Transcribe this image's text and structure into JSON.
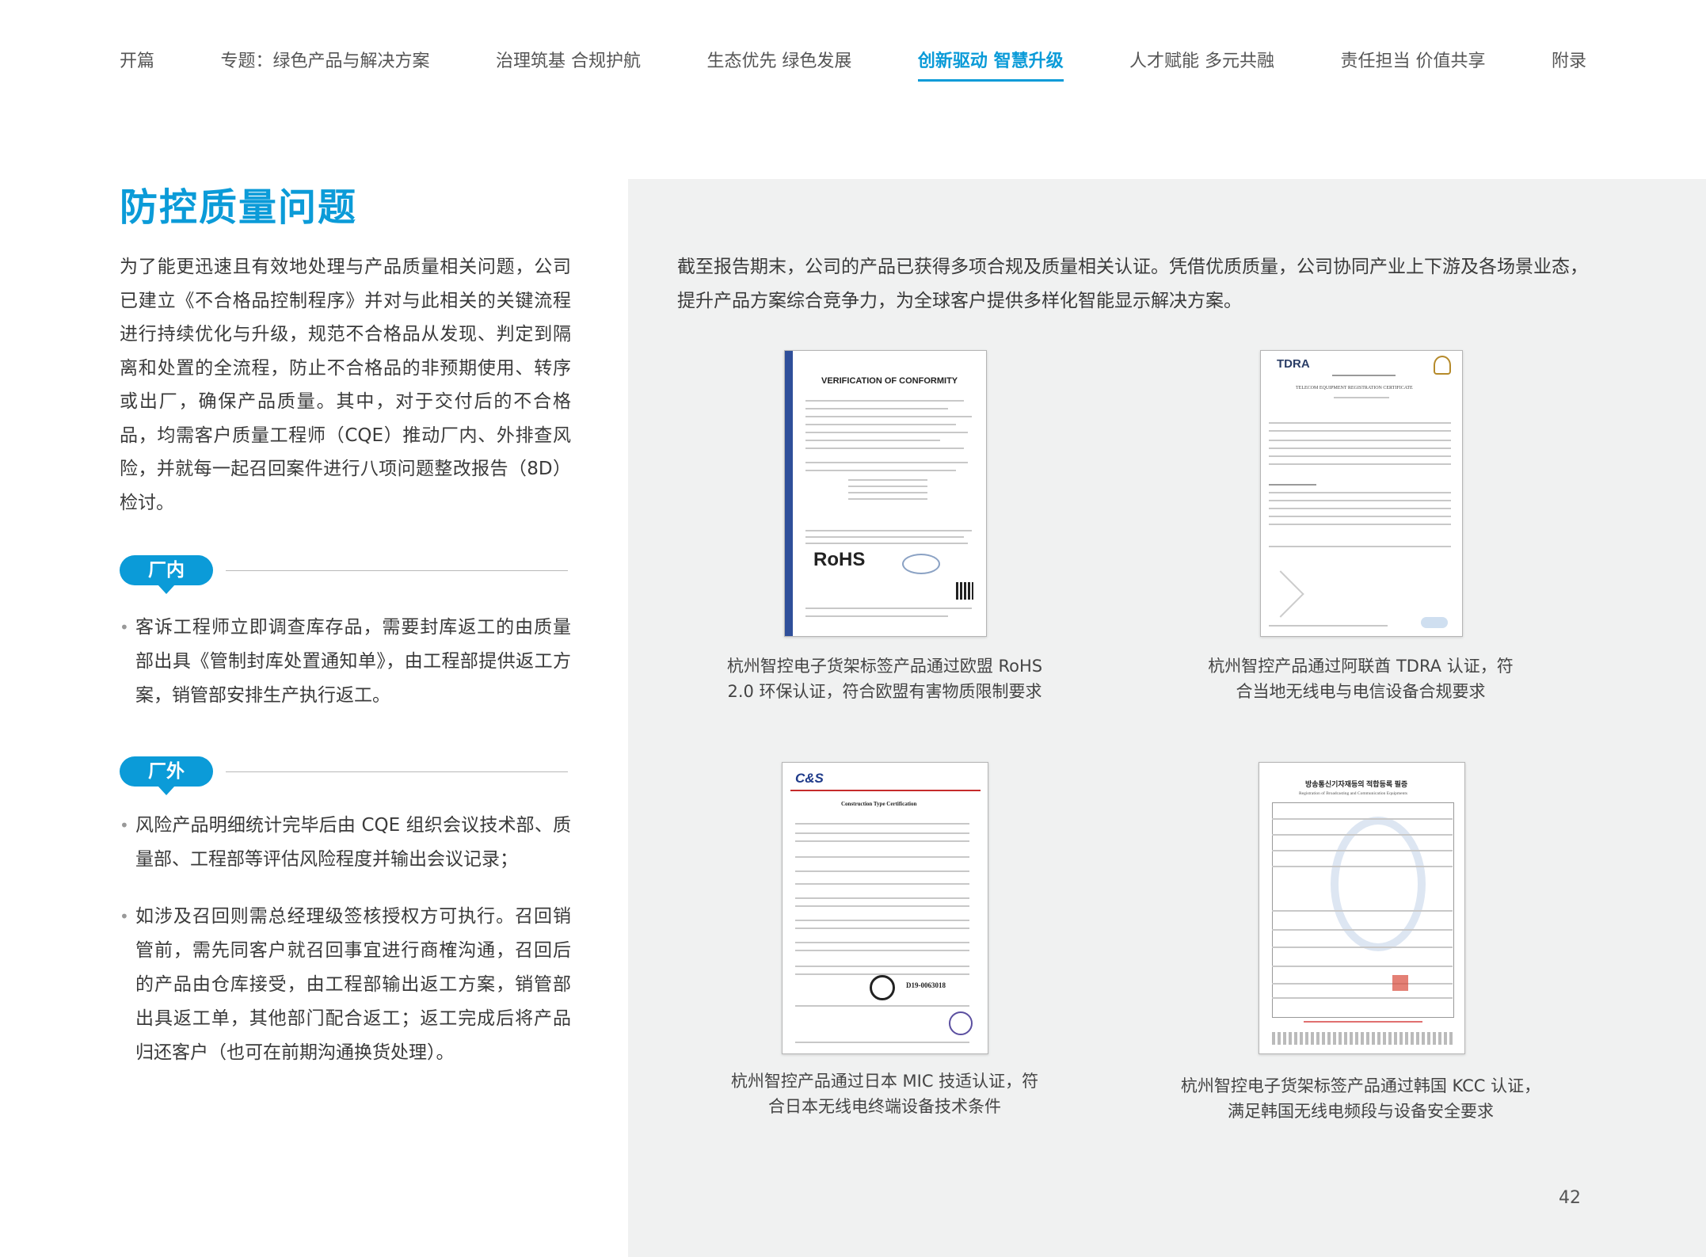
{
  "nav": {
    "items": [
      {
        "label": "开篇",
        "active": false
      },
      {
        "label": "专题：绿色产品与解决方案",
        "active": false
      },
      {
        "label": "治理筑基 合规护航",
        "active": false
      },
      {
        "label": "生态优先 绿色发展",
        "active": false
      },
      {
        "label": "创新驱动 智慧升级",
        "active": true
      },
      {
        "label": "人才赋能 多元共融",
        "active": false
      },
      {
        "label": "责任担当 价值共享",
        "active": false
      },
      {
        "label": "附录",
        "active": false
      }
    ],
    "accent_color": "#0b9bd8"
  },
  "left": {
    "title": "防控质量问题",
    "paragraph": "为了能更迅速且有效地处理与产品质量相关问题，公司已建立《不合格品控制程序》并对与此相关的关键流程进行持续优化与升级，规范不合格品从发现、判定到隔离和处置的全流程，防止不合格品的非预期使用、转序或出厂，确保产品质量。其中，对于交付后的不合格品，均需客户质量工程师（CQE）推动厂内、外排查风险，并就每一起召回案件进行八项问题整改报告（8D）检讨。",
    "factory_inside": {
      "tag": "厂内",
      "bullets": [
        "客诉工程师立即调查库存品，需要封库返工的由质量部出具《管制封库处置通知单》，由工程部提供返工方案，销管部安排生产执行返工。"
      ]
    },
    "factory_outside": {
      "tag": "厂外",
      "bullets": [
        "风险产品明细统计完毕后由 CQE 组织会议技术部、质量部、工程部等评估风险程度并输出会议记录；",
        "如涉及召回则需总经理级签核授权方可执行。召回销管前，需先同客户就召回事宜进行商榷沟通，召回后的产品由仓库接受，由工程部输出返工方案，销管部出具返工单，其他部门配合返工；返工完成后将产品归还客户（也可在前期沟通换货处理）。"
      ]
    }
  },
  "right": {
    "intro": "截至报告期末，公司的产品已获得多项合规及质量相关认证。凭借优质质量，公司协同产业上下游及各场景业态，提升产品方案综合竞争力，为全球客户提供多样化智能显示解决方案。",
    "certificates": [
      {
        "caption_line1": "杭州智控电子货架标签产品通过欧盟 RoHS",
        "caption_line2": "2.0 环保认证，符合欧盟有害物质限制要求",
        "doc_title": "VERIFICATION OF CONFORMITY",
        "doc_mark": "RoHS"
      },
      {
        "caption_line1": "杭州智控产品通过阿联酋 TDRA 认证，符",
        "caption_line2": "合当地无线电与电信设备合规要求",
        "doc_brand": "TDRA",
        "doc_title": "TELECOM EQUIPMENT REGISTRATION CERTIFICATE"
      },
      {
        "caption_line1": "杭州智控产品通过日本 MIC 技适认证，符",
        "caption_line2": "合日本无线电终端设备技术条件",
        "doc_brand": "C&S",
        "doc_title": "Construction Type Certification",
        "doc_number": "D19-0063018"
      },
      {
        "caption_line1": "杭州智控电子货架标签产品通过韩国 KCC 认证，",
        "caption_line2": "满足韩国无线电频段与设备安全要求",
        "doc_title": "방송통신기자재등의 적합등록 필증",
        "doc_subtitle": "Registration of Broadcasting and Communication Equipments"
      }
    ]
  },
  "page_number": "42"
}
